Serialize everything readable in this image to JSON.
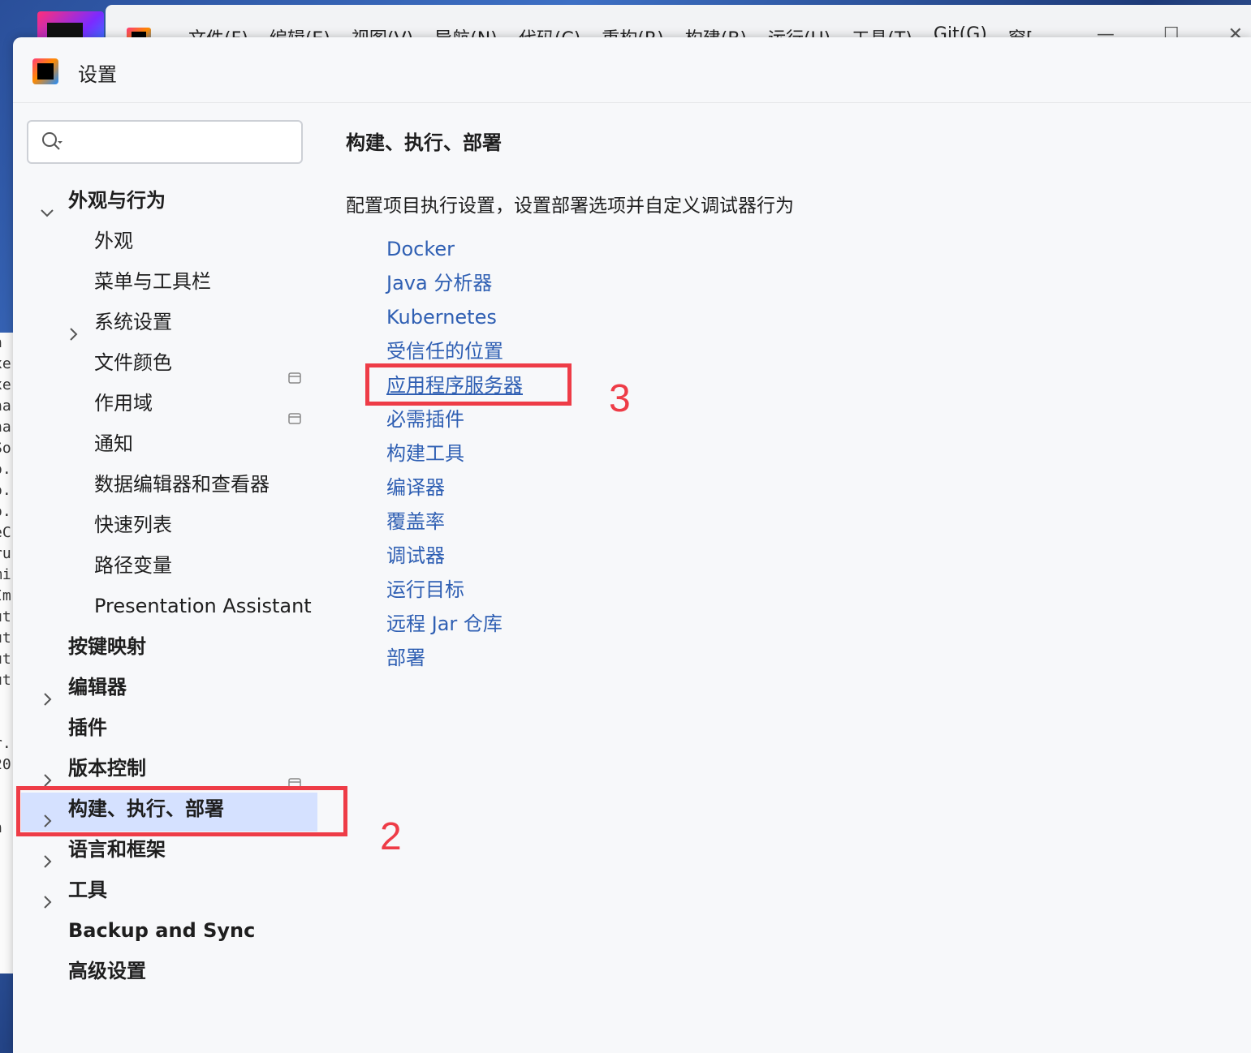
{
  "background": {
    "menu": [
      "文件(F)",
      "编辑(E)",
      "视图(V)",
      "导航(N)",
      "代码(C)",
      "重构(R)",
      "构建(B)",
      "运行(U)",
      "工具(T)",
      "Git(G)",
      "窗["
    ],
    "controls": [
      "—",
      "☐",
      "✕"
    ],
    "editor_fragments": [
      "n",
      "xe",
      "xe",
      "na",
      "na",
      "So",
      "o.",
      "o.",
      "o.",
      "eC",
      "ru",
      "mi",
      "Im",
      "ut",
      "ut",
      "ut",
      "ut",
      "",
      "",
      "r.",
      "20",
      "",
      "",
      "n"
    ]
  },
  "dialog": {
    "title": "设置"
  },
  "search": {
    "value": "",
    "placeholder": ""
  },
  "sidebar": {
    "items": [
      {
        "label": "外观与行为",
        "bold": true,
        "chevron": "down",
        "project_icon": false
      },
      {
        "label": "外观",
        "bold": false,
        "chevron": "",
        "project_icon": false
      },
      {
        "label": "菜单与工具栏",
        "bold": false,
        "chevron": "",
        "project_icon": false
      },
      {
        "label": "系统设置",
        "bold": false,
        "chevron": "right",
        "project_icon": false
      },
      {
        "label": "文件颜色",
        "bold": false,
        "chevron": "",
        "project_icon": true
      },
      {
        "label": "作用域",
        "bold": false,
        "chevron": "",
        "project_icon": true
      },
      {
        "label": "通知",
        "bold": false,
        "chevron": "",
        "project_icon": false
      },
      {
        "label": "数据编辑器和查看器",
        "bold": false,
        "chevron": "",
        "project_icon": false
      },
      {
        "label": "快速列表",
        "bold": false,
        "chevron": "",
        "project_icon": false
      },
      {
        "label": "路径变量",
        "bold": false,
        "chevron": "",
        "project_icon": false
      },
      {
        "label": "Presentation Assistant",
        "bold": false,
        "chevron": "",
        "project_icon": false
      },
      {
        "label": "按键映射",
        "bold": true,
        "chevron": "",
        "project_icon": false
      },
      {
        "label": "编辑器",
        "bold": true,
        "chevron": "right",
        "project_icon": false
      },
      {
        "label": "插件",
        "bold": true,
        "chevron": "",
        "project_icon": false
      },
      {
        "label": "版本控制",
        "bold": true,
        "chevron": "right",
        "project_icon": true
      },
      {
        "label": "构建、执行、部署",
        "bold": true,
        "chevron": "right",
        "project_icon": false,
        "selected": true
      },
      {
        "label": "语言和框架",
        "bold": true,
        "chevron": "right",
        "project_icon": false
      },
      {
        "label": "工具",
        "bold": true,
        "chevron": "right",
        "project_icon": false
      },
      {
        "label": "Backup and Sync",
        "bold": true,
        "chevron": "",
        "project_icon": false
      },
      {
        "label": "高级设置",
        "bold": true,
        "chevron": "",
        "project_icon": false
      }
    ]
  },
  "main": {
    "title": "构建、执行、部署",
    "description": "配置项目执行设置，设置部署选项并自定义调试器行为",
    "links": [
      {
        "label": "Docker"
      },
      {
        "label": "Java 分析器"
      },
      {
        "label": "Kubernetes"
      },
      {
        "label": "受信任的位置"
      },
      {
        "label": "应用程序服务器",
        "hovered": true
      },
      {
        "label": "必需插件"
      },
      {
        "label": "构建工具"
      },
      {
        "label": "编译器"
      },
      {
        "label": "覆盖率"
      },
      {
        "label": "调试器"
      },
      {
        "label": "运行目标"
      },
      {
        "label": "远程 Jar 仓库"
      },
      {
        "label": "部署"
      }
    ]
  },
  "annotations": [
    {
      "number": "2",
      "target": "构建、执行、部署"
    },
    {
      "number": "3",
      "target": "应用程序服务器"
    }
  ],
  "colors": {
    "link": "#2f5fb3",
    "selection": "#d5e1ff",
    "annotation": "#ee3c47"
  }
}
